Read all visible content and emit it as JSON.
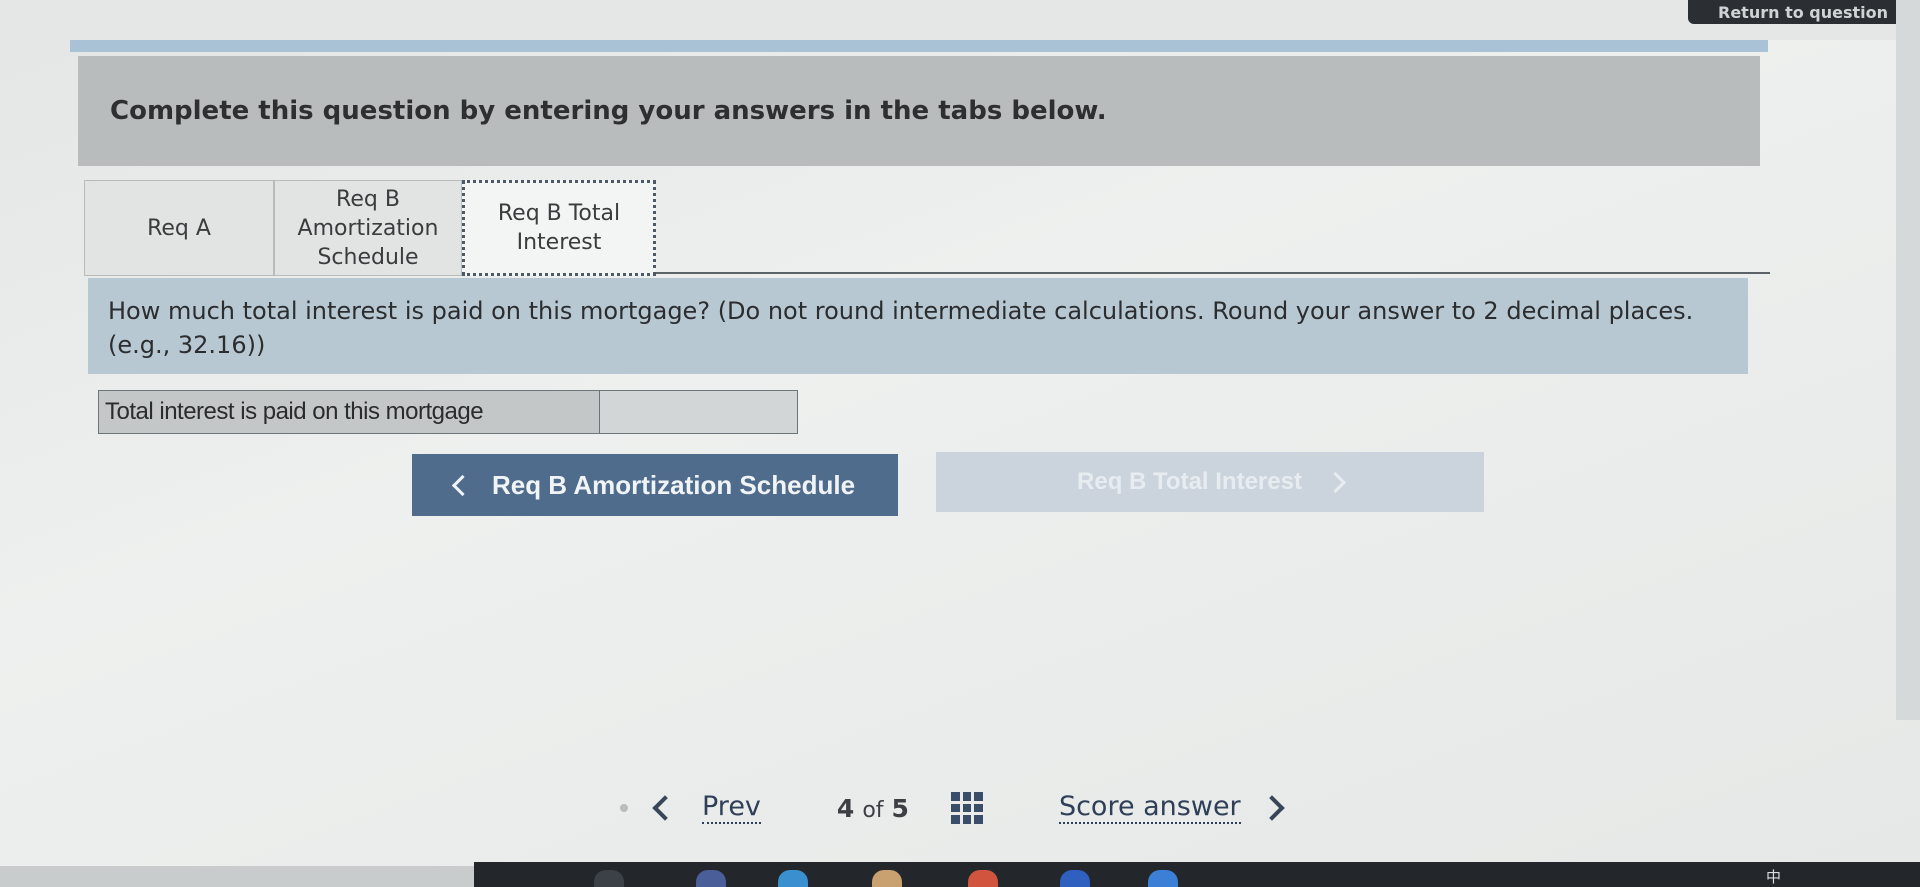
{
  "header": {
    "return_button": "Return to question"
  },
  "instructions": "Complete this question by entering your answers in the tabs below.",
  "tabs": [
    {
      "label": "Req A",
      "active": false
    },
    {
      "label": "Req B Amortization Schedule",
      "active": false
    },
    {
      "label": "Req B Total Interest",
      "active": true
    }
  ],
  "question": {
    "text": "How much total interest is paid on this mortgage? (Do not round intermediate calculations. Round your answer to 2 decimal places. (e.g., 32.16))"
  },
  "answer": {
    "label": "Total interest is paid on this mortgage",
    "value": ""
  },
  "navigation": {
    "prev_tab_label": "Req B Amortization Schedule",
    "next_tab_label": "Req B Total Interest"
  },
  "footer": {
    "prev_label": "Prev",
    "current_page": "4",
    "of_label": "of",
    "total_pages": "5",
    "score_label": "Score answer"
  },
  "system_tray": {
    "ime_label": "中"
  },
  "colors": {
    "instructions_bar": "#b9bcbc",
    "question_box": "#b8c8d3",
    "prev_button": "#4f6c8c",
    "next_button_disabled": "#cbd4dc",
    "link": "#2f3f57"
  }
}
